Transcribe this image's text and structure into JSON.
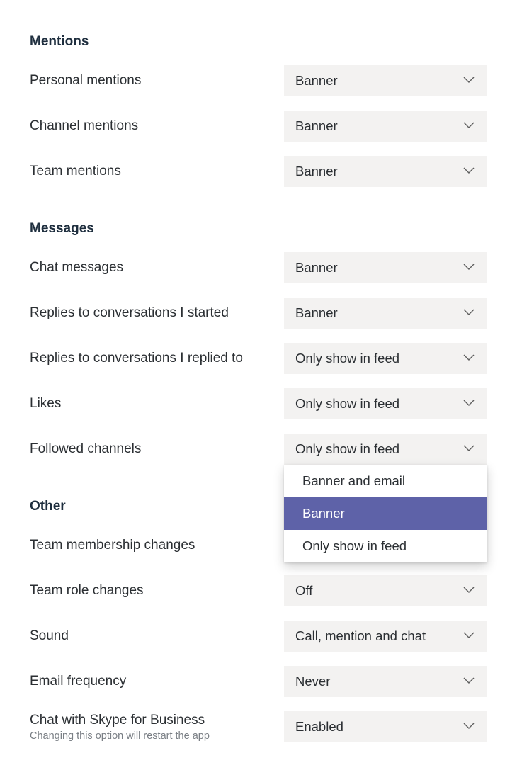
{
  "colors": {
    "dropdown_bg": "#f3f2f1",
    "accent": "#5e62a8",
    "text": "#2b2f33",
    "heading": "#1e2e3e",
    "subtext": "#7a7f85"
  },
  "sections": {
    "mentions": {
      "title": "Mentions",
      "personal": {
        "label": "Personal mentions",
        "value": "Banner"
      },
      "channel": {
        "label": "Channel mentions",
        "value": "Banner"
      },
      "team": {
        "label": "Team mentions",
        "value": "Banner"
      }
    },
    "messages": {
      "title": "Messages",
      "chat": {
        "label": "Chat messages",
        "value": "Banner"
      },
      "replies_started": {
        "label": "Replies to conversations I started",
        "value": "Banner"
      },
      "replies_replied": {
        "label": "Replies to conversations I replied to",
        "value": "Only show in feed"
      },
      "likes": {
        "label": "Likes",
        "value": "Only show in feed"
      },
      "followed_channels": {
        "label": "Followed channels",
        "value": "Only show in feed",
        "open": true,
        "options": [
          "Banner and email",
          "Banner",
          "Only show in feed"
        ],
        "highlighted": "Banner"
      }
    },
    "other": {
      "title": "Other",
      "team_membership": {
        "label": "Team membership changes",
        "value": ""
      },
      "team_role": {
        "label": "Team role changes",
        "value": "Off"
      },
      "sound": {
        "label": "Sound",
        "value": "Call, mention and chat"
      },
      "email_frequency": {
        "label": "Email frequency",
        "value": "Never"
      },
      "skype": {
        "label": "Chat with Skype for Business",
        "sublabel": "Changing this option will restart the app",
        "value": "Enabled"
      }
    }
  }
}
